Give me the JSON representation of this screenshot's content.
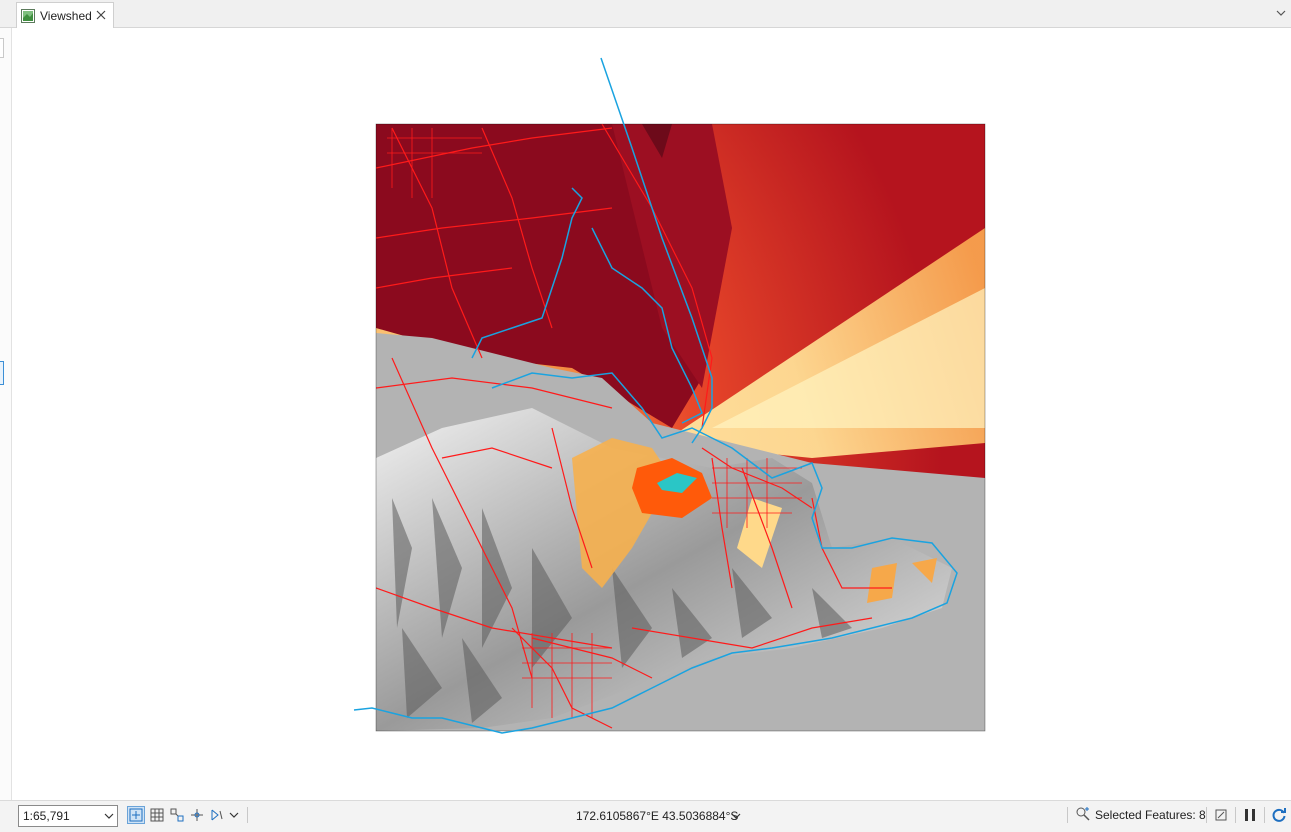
{
  "tab": {
    "title": "Viewshed",
    "icon": "map-icon",
    "close_icon": "close-icon"
  },
  "tabs_menu_icon": "chevron-down-icon",
  "map": {
    "layers": [
      "viewshed-raster",
      "hillshade",
      "roads",
      "coastline"
    ],
    "colors": {
      "roads": "#ff1a1a",
      "coastline": "#1aa3e0",
      "no_visibility": "#b3b3b3",
      "viewshed_dark": "#8b0a1e",
      "viewshed_mid": "#e8472a",
      "viewshed_light": "#ffe9a6",
      "observer": "#ff5a0a"
    }
  },
  "statusbar": {
    "scale": "1:65,791",
    "coordinates": "172.6105867°E 43.5036884°S",
    "selected_features": "Selected Features: 8",
    "icons": [
      "fixed-zoom-icon",
      "grid-icon",
      "snapping-icon",
      "measure-icon",
      "navigation-icon",
      "select-icon",
      "rotate-icon",
      "pause-icon",
      "refresh-icon"
    ]
  }
}
